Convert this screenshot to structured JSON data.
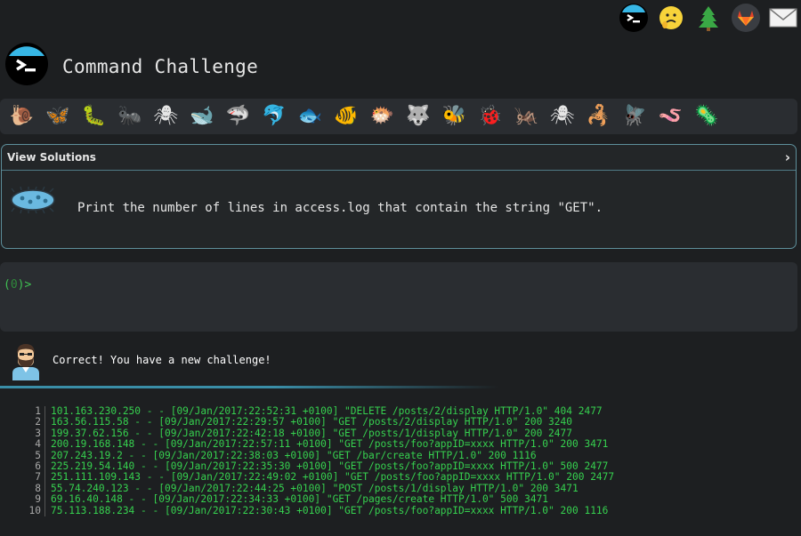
{
  "header": {
    "title": "Command Challenge",
    "icons": [
      "terminal-icon",
      "emoji-icon",
      "tree-icon",
      "gitlab-icon",
      "mail-icon"
    ]
  },
  "animals": [
    "🐌",
    "🦋",
    "🐛",
    "🐜",
    "🕷",
    "🐋",
    "🦈",
    "🐬",
    "🐟",
    "🐠",
    "🐡",
    "🐺",
    "🐝",
    "🐞",
    "🦗",
    "🕷",
    "🦂",
    "🪰",
    "🪱",
    "🦠"
  ],
  "challenge": {
    "view_solutions": "View Solutions",
    "chevron": "›",
    "text": "Print the number of lines in access.log that contain the string \"GET\"."
  },
  "terminal": {
    "prompt_open": "(",
    "prompt_code": "0",
    "prompt_close": ")>"
  },
  "feedback": "Correct! You have a new challenge!",
  "log": [
    {
      "n": "1",
      "text": "101.163.230.250 - - [09/Jan/2017:22:52:31 +0100] \"DELETE /posts/2/display HTTP/1.0\" 404 2477"
    },
    {
      "n": "2",
      "text": "163.56.115.58 - - [09/Jan/2017:22:29:57 +0100] \"GET /posts/2/display HTTP/1.0\" 200 3240"
    },
    {
      "n": "3",
      "text": "199.37.62.156 - - [09/Jan/2017:22:42:18 +0100] \"GET /posts/1/display HTTP/1.0\" 200 2477"
    },
    {
      "n": "4",
      "text": "200.19.168.148 - - [09/Jan/2017:22:57:11 +0100] \"GET /posts/foo?appID=xxxx HTTP/1.0\" 200 3471"
    },
    {
      "n": "5",
      "text": "207.243.19.2 - - [09/Jan/2017:22:38:03 +0100] \"GET /bar/create HTTP/1.0\" 200 1116"
    },
    {
      "n": "6",
      "text": "225.219.54.140 - - [09/Jan/2017:22:35:30 +0100] \"GET /posts/foo?appID=xxxx HTTP/1.0\" 500 2477"
    },
    {
      "n": "7",
      "text": "251.111.109.143 - - [09/Jan/2017:22:49:02 +0100] \"GET /posts/foo?appID=xxxx HTTP/1.0\" 200 2477"
    },
    {
      "n": "8",
      "text": "55.74.240.123 - - [09/Jan/2017:22:44:25 +0100] \"POST /posts/1/display HTTP/1.0\" 200 3471"
    },
    {
      "n": "9",
      "text": "69.16.40.148 - - [09/Jan/2017:22:34:33 +0100] \"GET /pages/create HTTP/1.0\" 500 3471"
    },
    {
      "n": "10",
      "text": "75.113.188.234 - - [09/Jan/2017:22:30:43 +0100] \"GET /posts/foo?appID=xxxx HTTP/1.0\" 200 1116"
    }
  ],
  "colors": {
    "background": "#1d1f21",
    "panel": "#2a2d31",
    "accent": "#5e8f9b",
    "log_text": "#36d14f"
  }
}
